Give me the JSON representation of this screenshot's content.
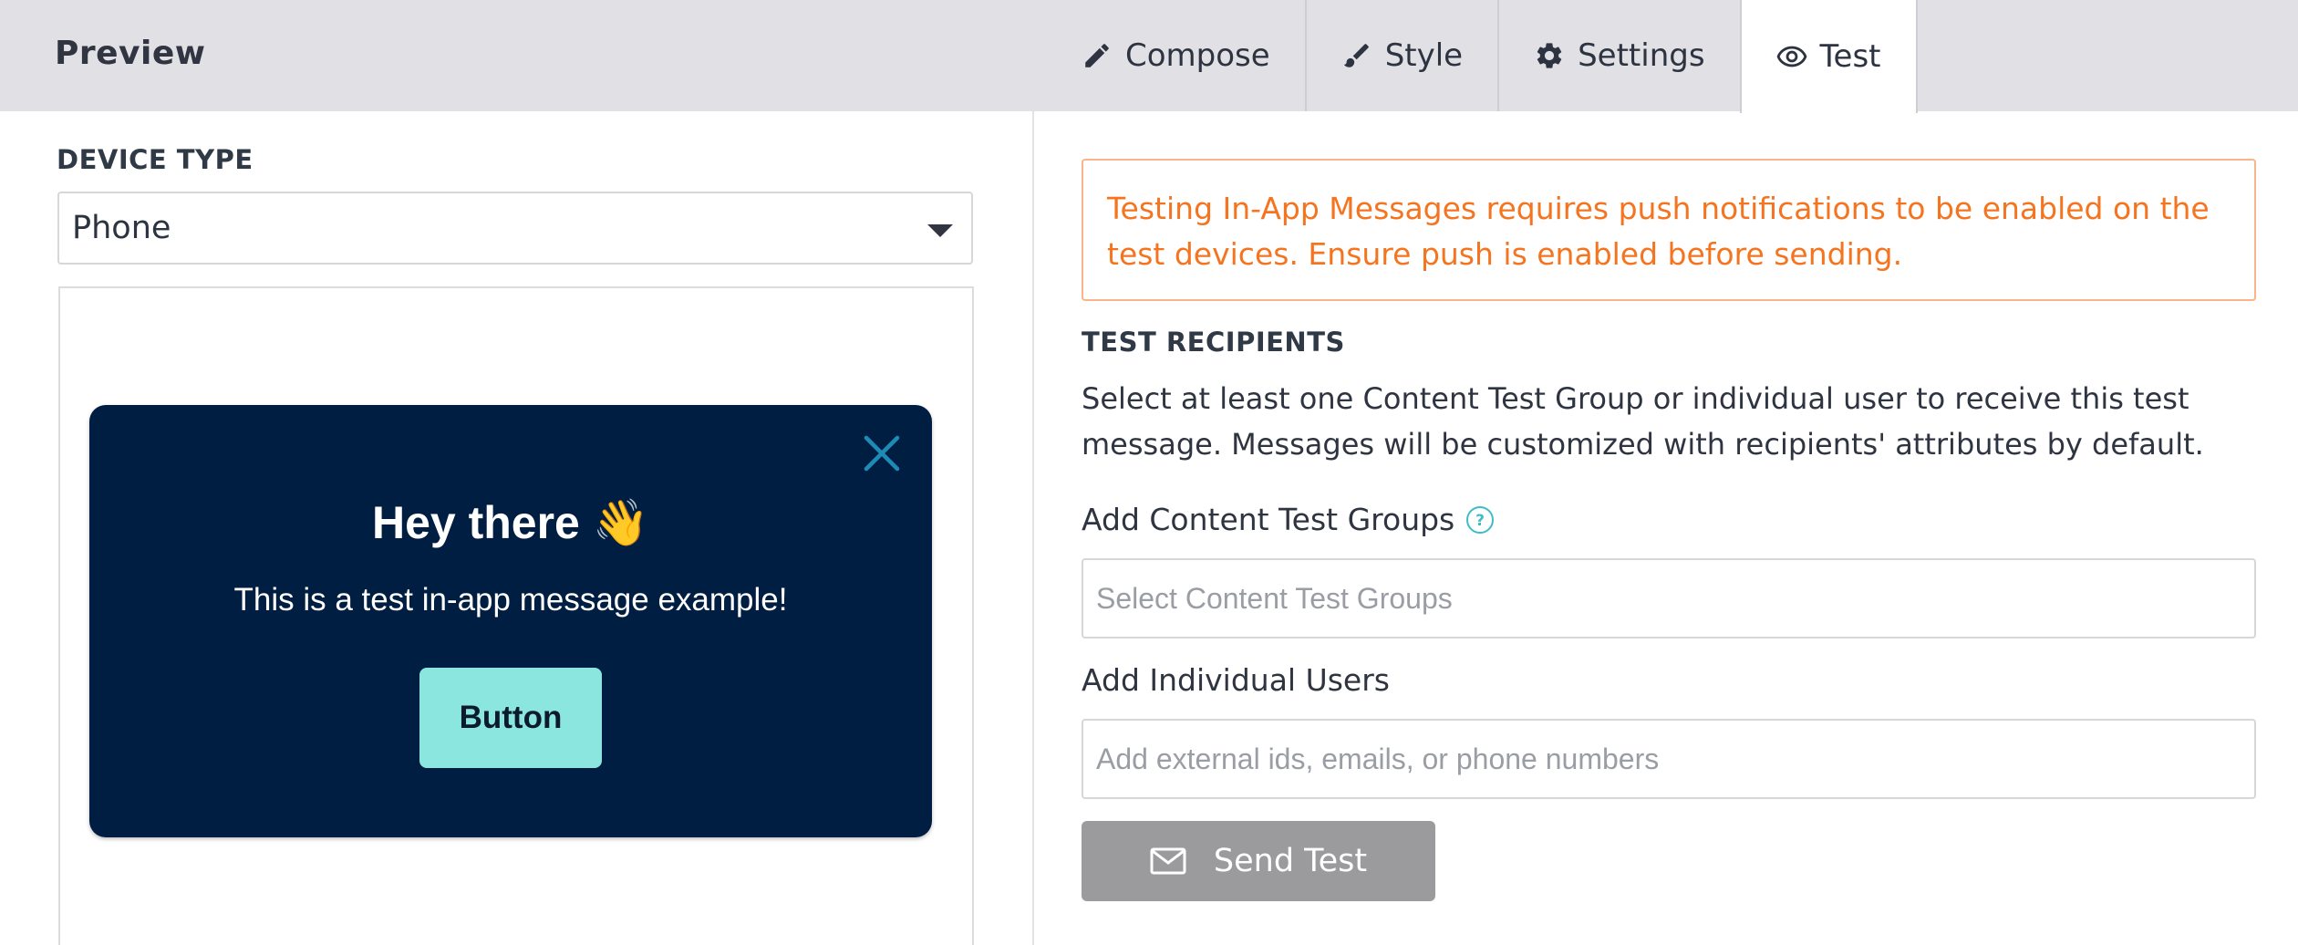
{
  "header": {
    "title": "Preview",
    "tabs": [
      {
        "label": "Compose",
        "icon": "pencil-icon"
      },
      {
        "label": "Style",
        "icon": "brush-icon"
      },
      {
        "label": "Settings",
        "icon": "gear-icon"
      },
      {
        "label": "Test",
        "icon": "eye-icon",
        "active": true
      }
    ]
  },
  "left": {
    "device_type_label": "DEVICE TYPE",
    "device_type_value": "Phone",
    "message": {
      "title": "Hey there 👋",
      "body": "This is a test in-app message example!",
      "button_label": "Button",
      "background_color": "#001d42",
      "button_color": "#8be6e0",
      "close_color": "#1d8bb5"
    }
  },
  "right": {
    "alert_text": "Testing In-App Messages requires push notifications to be enabled on the test devices. Ensure push is enabled before sending.",
    "alert_color": "#f5741f",
    "recipients_label": "TEST RECIPIENTS",
    "recipients_description": "Select at least one Content Test Group or individual user to receive this test message. Messages will be customized with recipients' attributes by default.",
    "groups_label": "Add Content Test Groups",
    "groups_placeholder": "Select Content Test Groups",
    "users_label": "Add Individual Users",
    "users_placeholder": "Add external ids, emails, or phone numbers",
    "send_button_label": "Send Test"
  }
}
